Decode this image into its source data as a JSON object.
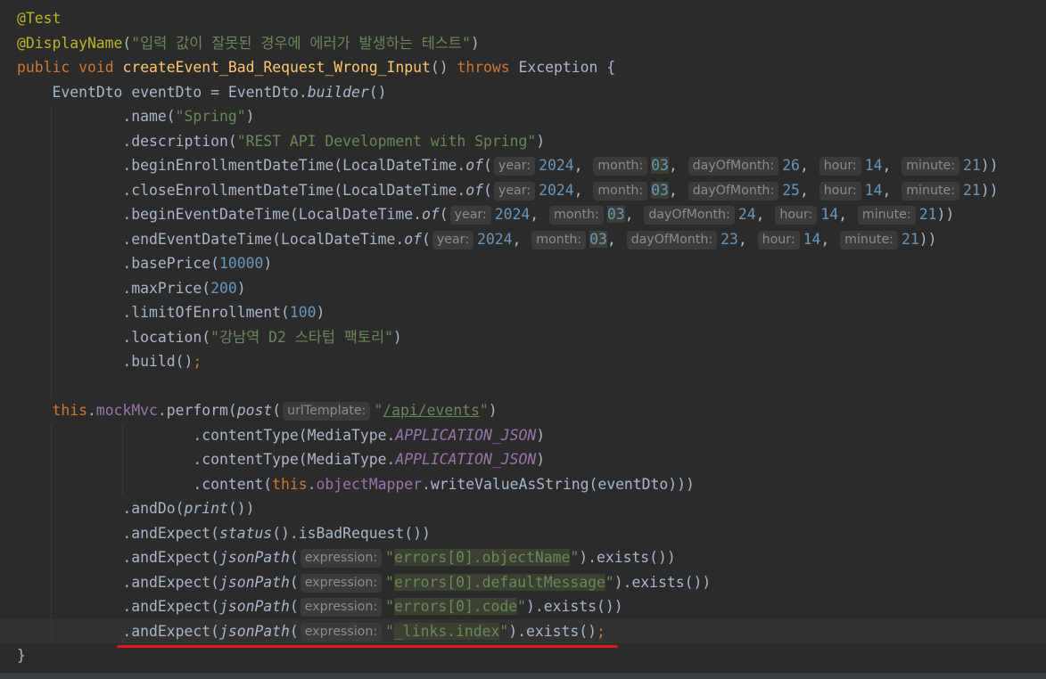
{
  "code": {
    "annotation_test": "@Test",
    "annotation_display": "@DisplayName",
    "display_name_string": "\"입력 값이 잘못된 경우에 에러가 발생하는 테스트\"",
    "kw_public": "public",
    "kw_void": "void",
    "method_name": "createEvent_Bad_Request_Wrong_Input",
    "kw_throws": "throws",
    "exception_type": "Exception",
    "type_name": "EventDto",
    "var_name": "eventDto",
    "builder_call": "builder",
    "name_value": "\"Spring\"",
    "description_value": "\"REST API Development with Spring\"",
    "local_date_time": "LocalDateTime",
    "of_call": "of",
    "hint_year": "year:",
    "hint_month": "month:",
    "hint_day": "dayOfMonth:",
    "hint_hour": "hour:",
    "hint_minute": "minute:",
    "hint_url": "urlTemplate:",
    "hint_expression": "expression:",
    "year": "2024",
    "month": "03",
    "hour": "14",
    "minute": "21",
    "day_begin_enroll": "26",
    "day_close_enroll": "25",
    "day_begin_event": "24",
    "day_end_event": "23",
    "base_price": "10000",
    "max_price": "200",
    "limit": "100",
    "location_value": "\"강남역 D2 스타텁 팩토리\"",
    "kw_this": "this",
    "mock_mvc": "mockMvc",
    "perform": "perform",
    "post": "post",
    "url_path": "/api/events",
    "media_type": "MediaType",
    "app_json": "APPLICATION_JSON",
    "object_mapper": "objectMapper",
    "print": "print",
    "status": "status",
    "json_path": "jsonPath",
    "path_object_name_a": "errors",
    "path_object_name_b": "[0].objectName",
    "path_default_msg_b": "[0].defaultMessage",
    "path_code_b": "[0].code",
    "path_links_index": "_links.index"
  }
}
